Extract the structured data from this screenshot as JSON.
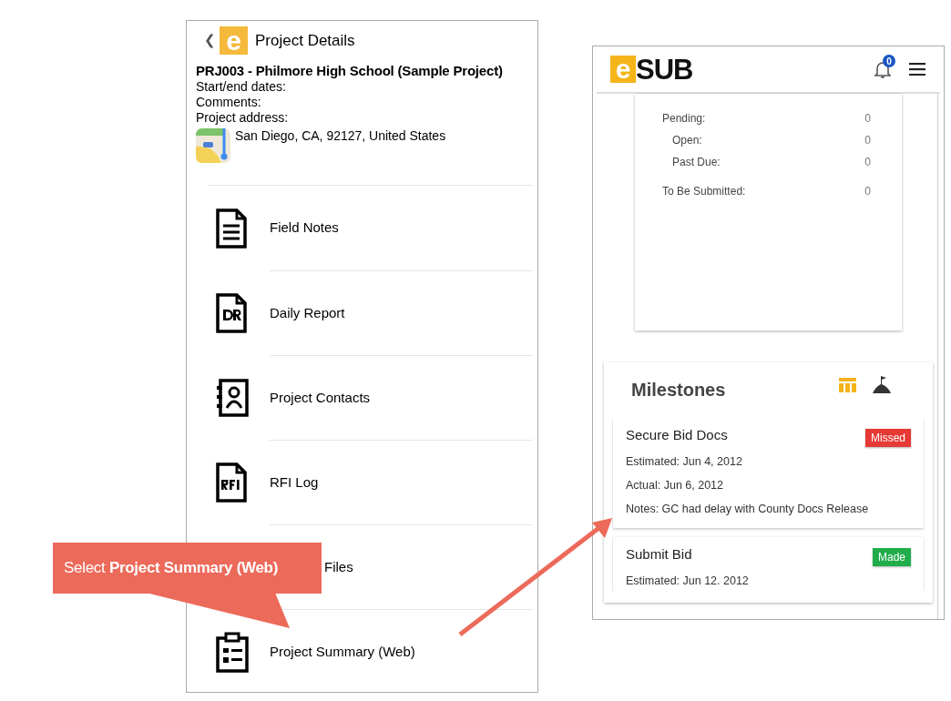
{
  "project_details": {
    "back": "❮",
    "logo_mark": "e",
    "title": "Project Details",
    "project_name": "PRJ003 - Philmore High School (Sample Project)",
    "fields": [
      "Start/end dates:",
      "Comments:",
      "Project address:"
    ],
    "address": "San Diego, CA, 92127, United States",
    "menu": [
      {
        "kind": "notes",
        "label": "Field Notes"
      },
      {
        "kind": "daily-report",
        "label": "Daily Report"
      },
      {
        "kind": "contacts",
        "label": "Project Contacts"
      },
      {
        "kind": "rfi",
        "label": "RFI Log"
      },
      {
        "kind": "covered",
        "label": "Files"
      },
      {
        "kind": "summary",
        "label": "Project Summary (Web)"
      }
    ]
  },
  "web_view": {
    "logo_mark": "e",
    "logo_word": "SUB",
    "notification_count": "0",
    "summary_rows": [
      {
        "label": "Pending:",
        "value": "0",
        "indented": false
      },
      {
        "label": "Open:",
        "value": "0",
        "indented": true
      },
      {
        "label": "Past Due:",
        "value": "0",
        "indented": true
      },
      {
        "label": "To Be Submitted:",
        "value": "0",
        "indented": false
      }
    ],
    "milestones": {
      "title": "Milestones",
      "items": [
        {
          "name": "Secure Bid Docs",
          "status": "Missed",
          "color": "#e53935",
          "lines": [
            "Estimated: Jun 4, 2012",
            "Actual: Jun 6, 2012",
            "Notes: GC had delay with County Docs Release"
          ]
        },
        {
          "name": "Submit Bid",
          "status": "Made",
          "color": "#1fad4a",
          "lines": [
            "Estimated: Jun 12. 2012"
          ]
        }
      ]
    }
  },
  "callout": {
    "text": "Select **Project Summary (Web)**"
  }
}
